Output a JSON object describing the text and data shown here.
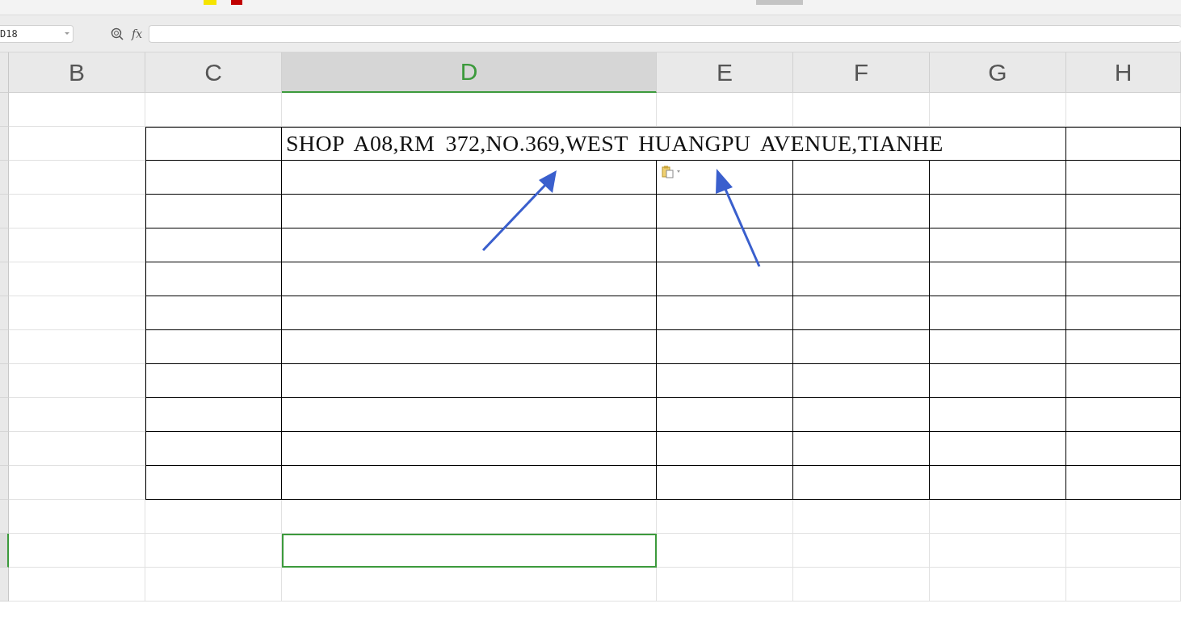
{
  "name_box": {
    "value": "D18"
  },
  "formula_bar": {
    "fx_label": "fx"
  },
  "columns": [
    {
      "label": "B",
      "selected": false
    },
    {
      "label": "C",
      "selected": false
    },
    {
      "label": "D",
      "selected": true
    },
    {
      "label": "E",
      "selected": false
    },
    {
      "label": "F",
      "selected": false
    },
    {
      "label": "G",
      "selected": false
    },
    {
      "label": "H",
      "selected": false
    }
  ],
  "rows": [
    {
      "bordered": false,
      "selected": false
    },
    {
      "bordered": true,
      "selected": false,
      "text": "SHOP A08,RM 372,NO.369,WEST HUANGPU AVENUE,TIANHE"
    },
    {
      "bordered": true,
      "selected": false,
      "paste_options": true
    },
    {
      "bordered": true,
      "selected": false
    },
    {
      "bordered": true,
      "selected": false
    },
    {
      "bordered": true,
      "selected": false
    },
    {
      "bordered": true,
      "selected": false
    },
    {
      "bordered": true,
      "selected": false
    },
    {
      "bordered": true,
      "selected": false
    },
    {
      "bordered": true,
      "selected": false
    },
    {
      "bordered": true,
      "selected": false
    },
    {
      "bordered": true,
      "selected": false
    },
    {
      "bordered": false,
      "selected": false
    },
    {
      "bordered": false,
      "selected": true
    },
    {
      "bordered": false,
      "selected": false
    }
  ]
}
